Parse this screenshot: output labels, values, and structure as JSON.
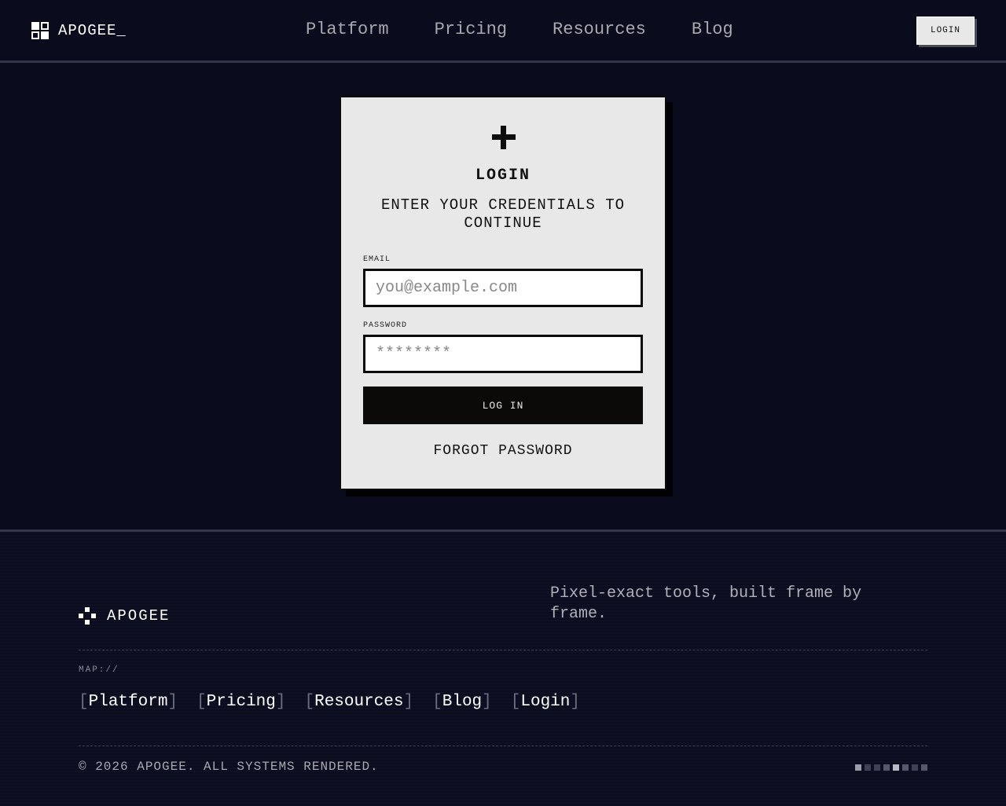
{
  "header": {
    "brand": "APOGEE_",
    "nav": [
      "Platform",
      "Pricing",
      "Resources",
      "Blog"
    ],
    "login_label": "LOGIN"
  },
  "card": {
    "title": "LOGIN",
    "subtitle": "ENTER YOUR CREDENTIALS TO CONTINUE",
    "email_label": "EMAIL",
    "email_placeholder": "you@example.com",
    "password_label": "PASSWORD",
    "password_placeholder": "********",
    "submit_label": "LOG IN",
    "forgot_label": "FORGOT PASSWORD"
  },
  "footer": {
    "brand": "APOGEE",
    "tagline": "Pixel-exact tools, built frame by frame.",
    "map_label": "MAP://",
    "links": [
      "Platform",
      "Pricing",
      "Resources",
      "Blog",
      "Login"
    ],
    "copyright": "© 2026 APOGEE. ALL SYSTEMS RENDERED."
  },
  "colors": {
    "background": "#0a0b1c",
    "card": "#e8e8e8",
    "button": "#0b0a08"
  },
  "icons": {
    "brand": "grid-logo-icon",
    "card": "plus-icon",
    "footer_brand": "pixel-cross-icon"
  }
}
